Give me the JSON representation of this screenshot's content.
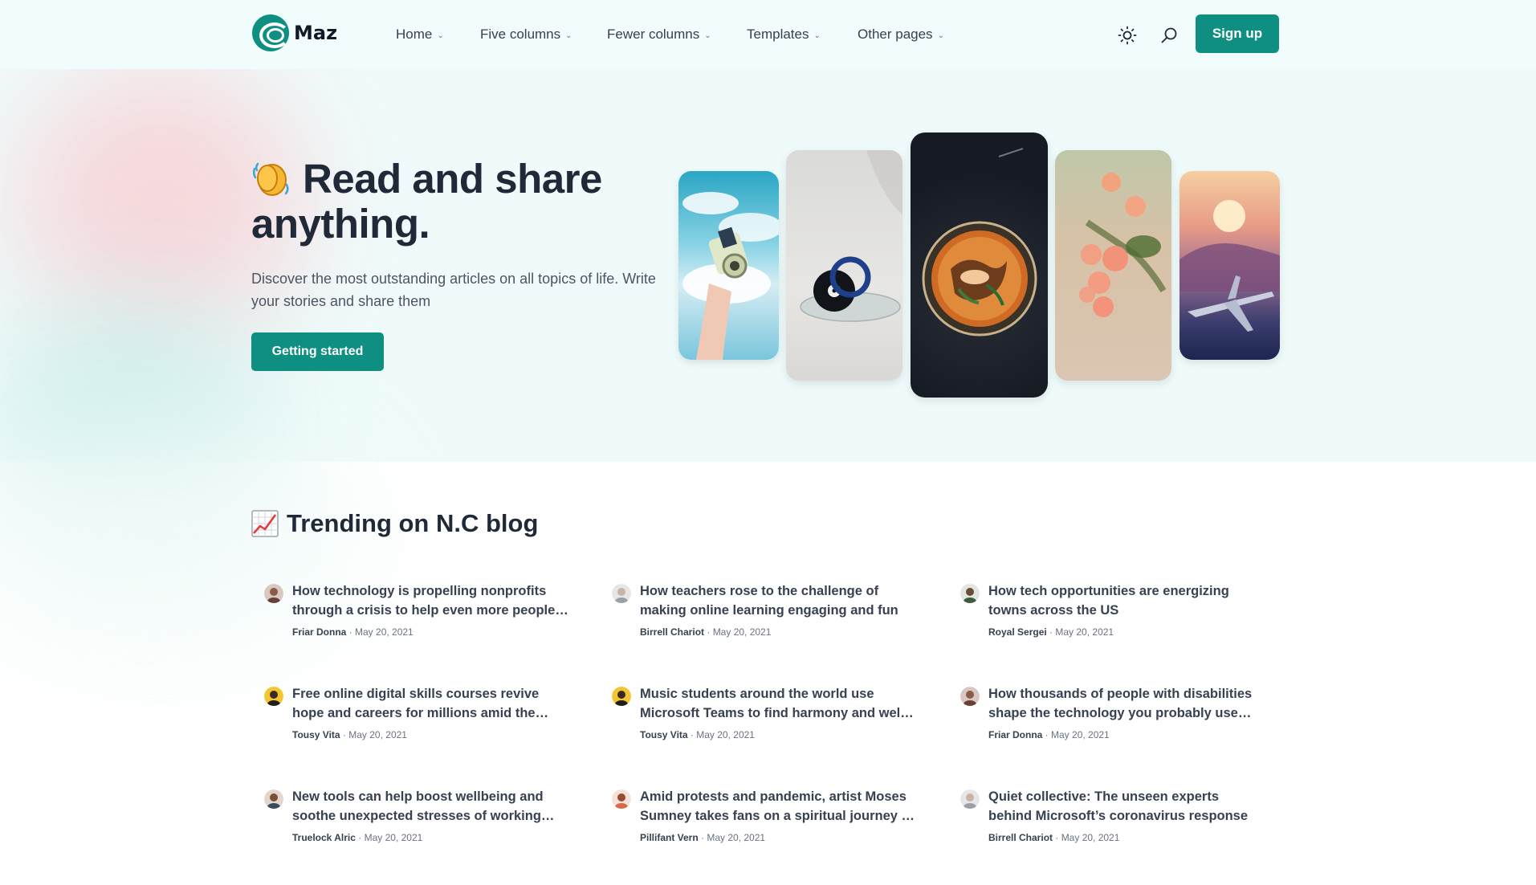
{
  "brand": {
    "name": "Maz"
  },
  "nav": {
    "items": [
      "Home",
      "Five columns",
      "Fewer columns",
      "Templates",
      "Other pages"
    ],
    "theme_icon": "sun-icon",
    "search_icon": "search-icon",
    "signup_label": "Sign up"
  },
  "hero": {
    "emoji": "waving-hands-emoji",
    "title": "Read and share anything.",
    "description": "Discover the most outstanding articles on all topics of life. Write your stories and share them",
    "cta_label": "Getting started",
    "gallery": [
      "instant-camera-photo",
      "vinyl-speaker-photo",
      "soup-bowl-photo",
      "roses-photo",
      "airplane-sunset-photo"
    ]
  },
  "trending": {
    "emoji": "chart-increasing-emoji",
    "title": "Trending on N.C blog",
    "posts": [
      {
        "title": "How technology is propelling nonprofits through a crisis to help even more people in need",
        "author": "Friar Donna",
        "date": "May 20, 2021"
      },
      {
        "title": "How teachers rose to the challenge of making online learning engaging and fun",
        "author": "Birrell Chariot",
        "date": "May 20, 2021"
      },
      {
        "title": "How tech opportunities are energizing towns across the US",
        "author": "Royal Sergei",
        "date": "May 20, 2021"
      },
      {
        "title": "Free online digital skills courses revive hope and careers for millions amid the pandemic",
        "author": "Tousy Vita",
        "date": "May 20, 2021"
      },
      {
        "title": "Music students around the world use Microsoft Teams to find harmony and well-being",
        "author": "Tousy Vita",
        "date": "May 20, 2021"
      },
      {
        "title": "How thousands of people with disabilities shape the technology you probably use every day",
        "author": "Friar Donna",
        "date": "May 20, 2021"
      },
      {
        "title": "New tools can help boost wellbeing and soothe unexpected stresses of working from home",
        "author": "Truelock Alric",
        "date": "May 20, 2021"
      },
      {
        "title": "Amid protests and pandemic, artist Moses Sumney takes fans on a spiritual journey in a new film",
        "author": "Pillifant Vern",
        "date": "May 20, 2021"
      },
      {
        "title": "Quiet collective: The unseen experts behind Microsoft’s coronavirus response",
        "author": "Birrell Chariot",
        "date": "May 20, 2021"
      }
    ]
  },
  "colors": {
    "accent": "#0f8f82",
    "hero_bg": "#effbfb",
    "text": "#1f2937"
  }
}
